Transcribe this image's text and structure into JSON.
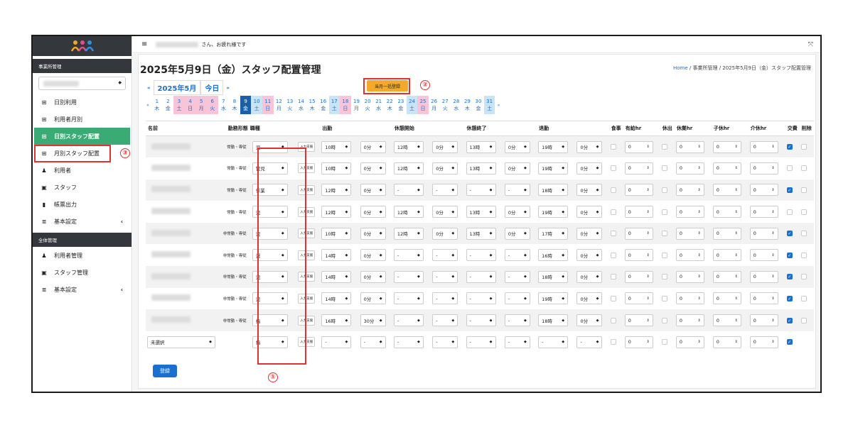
{
  "topbar": {
    "greeting": "さん、お疲れ様です",
    "menu_icon": "hamburger-icon",
    "expand_icon": "expand-icon"
  },
  "sidebar": {
    "section1": "事業所管理",
    "section2": "全体管理",
    "items1": [
      {
        "icon": "table-icon",
        "label": "日別利用"
      },
      {
        "icon": "table-icon",
        "label": "利用者月別"
      },
      {
        "icon": "table-icon",
        "label": "日別スタッフ配置"
      },
      {
        "icon": "table-icon",
        "label": "月別スタッフ配置"
      },
      {
        "icon": "user-icon",
        "label": "利用者"
      },
      {
        "icon": "id-card-icon",
        "label": "スタッフ"
      },
      {
        "icon": "book-icon",
        "label": "帳票出力"
      },
      {
        "icon": "database-icon",
        "label": "基本設定"
      }
    ],
    "items2": [
      {
        "icon": "user-icon",
        "label": "利用者管理"
      },
      {
        "icon": "id-card-icon",
        "label": "スタッフ管理"
      },
      {
        "icon": "database-icon",
        "label": "基本設定"
      }
    ]
  },
  "page": {
    "title": "2025年5月9日（金）スタッフ配置管理",
    "month": "2025年5月",
    "today": "今日",
    "bulk": "当月一括登録",
    "submit": "登録"
  },
  "breadcrumb": {
    "home": "Home",
    "rest": " / 事業所管理 / 2025年5月9日（金）スタッフ配置管理"
  },
  "annotations": {
    "c1": "①",
    "c2": "②",
    "c3": "③"
  },
  "days": [
    {
      "d": "1",
      "w": "木",
      "t": ""
    },
    {
      "d": "2",
      "w": "金",
      "t": ""
    },
    {
      "d": "3",
      "w": "土",
      "t": "pink"
    },
    {
      "d": "4",
      "w": "日",
      "t": "pink"
    },
    {
      "d": "5",
      "w": "月",
      "t": "pink"
    },
    {
      "d": "6",
      "w": "火",
      "t": "pink"
    },
    {
      "d": "7",
      "w": "水",
      "t": ""
    },
    {
      "d": "8",
      "w": "木",
      "t": ""
    },
    {
      "d": "9",
      "w": "金",
      "t": "cur"
    },
    {
      "d": "10",
      "w": "土",
      "t": "blue"
    },
    {
      "d": "11",
      "w": "日",
      "t": "pink"
    },
    {
      "d": "12",
      "w": "月",
      "t": ""
    },
    {
      "d": "13",
      "w": "火",
      "t": ""
    },
    {
      "d": "14",
      "w": "水",
      "t": ""
    },
    {
      "d": "15",
      "w": "木",
      "t": ""
    },
    {
      "d": "16",
      "w": "金",
      "t": ""
    },
    {
      "d": "17",
      "w": "土",
      "t": "blue"
    },
    {
      "d": "18",
      "w": "日",
      "t": "pink"
    },
    {
      "d": "19",
      "w": "月",
      "t": ""
    },
    {
      "d": "20",
      "w": "火",
      "t": ""
    },
    {
      "d": "21",
      "w": "水",
      "t": ""
    },
    {
      "d": "22",
      "w": "木",
      "t": ""
    },
    {
      "d": "23",
      "w": "金",
      "t": ""
    },
    {
      "d": "24",
      "w": "土",
      "t": "blue"
    },
    {
      "d": "25",
      "w": "日",
      "t": "pink"
    },
    {
      "d": "26",
      "w": "月",
      "t": ""
    },
    {
      "d": "27",
      "w": "火",
      "t": ""
    },
    {
      "d": "28",
      "w": "水",
      "t": ""
    },
    {
      "d": "29",
      "w": "木",
      "t": ""
    },
    {
      "d": "30",
      "w": "金",
      "t": ""
    },
    {
      "d": "31",
      "w": "土",
      "t": "blue"
    }
  ],
  "columns": [
    "名前",
    "勤務形態",
    "職種",
    "出勤",
    "休憩開始",
    "休憩終了",
    "退勤",
    "食事",
    "有給hr",
    "休出",
    "休業hr",
    "子休hr",
    "介休hr",
    "交費",
    "削除"
  ],
  "input_btn": "入力支援",
  "unselected": "未選択",
  "rows": [
    {
      "emp": "常勤・専従",
      "job": "児",
      "in_h": "10時",
      "in_m": "0分",
      "bs_h": "12時",
      "bs_m": "0分",
      "be_h": "13時",
      "be_m": "0分",
      "out_h": "19時",
      "out_m": "0分",
      "pay": "0",
      "kyu": "0",
      "ko": "0",
      "kai": "0",
      "fare": true
    },
    {
      "emp": "常勤・専従",
      "job": "管児",
      "in_h": "10時",
      "in_m": "0分",
      "bs_h": "12時",
      "bs_m": "0分",
      "be_h": "13時",
      "be_m": "0分",
      "out_h": "19時",
      "out_m": "0分",
      "pay": "0",
      "kyu": "0",
      "ko": "0",
      "kai": "0",
      "fare": false
    },
    {
      "emp": "常勤・専従",
      "job": "作業",
      "in_h": "12時",
      "in_m": "0分",
      "bs_h": "-",
      "bs_m": "-",
      "be_h": "-",
      "be_m": "-",
      "out_h": "18時",
      "out_m": "0分",
      "pay": "0",
      "kyu": "0",
      "ko": "0",
      "kai": "0",
      "fare": true
    },
    {
      "emp": "常勤・専従",
      "job": "児",
      "in_h": "12時",
      "in_m": "0分",
      "bs_h": "12時",
      "bs_m": "0分",
      "be_h": "13時",
      "be_m": "0分",
      "out_h": "19時",
      "out_m": "0分",
      "pay": "0",
      "kyu": "0",
      "ko": "0",
      "kai": "0",
      "fare": false
    },
    {
      "emp": "非常勤・専従",
      "job": "児",
      "in_h": "10時",
      "in_m": "0分",
      "bs_h": "12時",
      "bs_m": "0分",
      "be_h": "13時",
      "be_m": "0分",
      "out_h": "17時",
      "out_m": "0分",
      "pay": "0",
      "kyu": "0",
      "ko": "0",
      "kai": "0",
      "fare": true
    },
    {
      "emp": "非常勤・専従",
      "job": "運",
      "in_h": "14時",
      "in_m": "0分",
      "bs_h": "-",
      "bs_m": "-",
      "be_h": "-",
      "be_m": "-",
      "out_h": "16時",
      "out_m": "0分",
      "pay": "0",
      "kyu": "0",
      "ko": "0",
      "kai": "0",
      "fare": true
    },
    {
      "emp": "非常勤・専従",
      "job": "児",
      "in_h": "14時",
      "in_m": "0分",
      "bs_h": "-",
      "bs_m": "-",
      "be_h": "-",
      "be_m": "-",
      "out_h": "18時",
      "out_m": "0分",
      "pay": "0",
      "kyu": "0",
      "ko": "0",
      "kai": "0",
      "fare": true
    },
    {
      "emp": "非常勤・専従",
      "job": "児",
      "in_h": "14時",
      "in_m": "0分",
      "bs_h": "-",
      "bs_m": "-",
      "be_h": "-",
      "be_m": "-",
      "out_h": "19時",
      "out_m": "0分",
      "pay": "0",
      "kyu": "0",
      "ko": "0",
      "kai": "0",
      "fare": true
    },
    {
      "emp": "非常勤・専従",
      "job": "指",
      "in_h": "16時",
      "in_m": "30分",
      "bs_h": "-",
      "bs_m": "-",
      "be_h": "-",
      "be_m": "-",
      "out_h": "18時",
      "out_m": "0分",
      "pay": "0",
      "kyu": "0",
      "ko": "0",
      "kai": "0",
      "fare": true
    }
  ],
  "last_row": {
    "job": "指",
    "in_h": "-",
    "in_m": "-",
    "bs_h": "-",
    "bs_m": "-",
    "be_h": "-",
    "be_m": "-",
    "out_h": "-",
    "out_m": "-",
    "pay": "0",
    "kyu": "0",
    "ko": "0",
    "kai": "0",
    "fare": true
  }
}
